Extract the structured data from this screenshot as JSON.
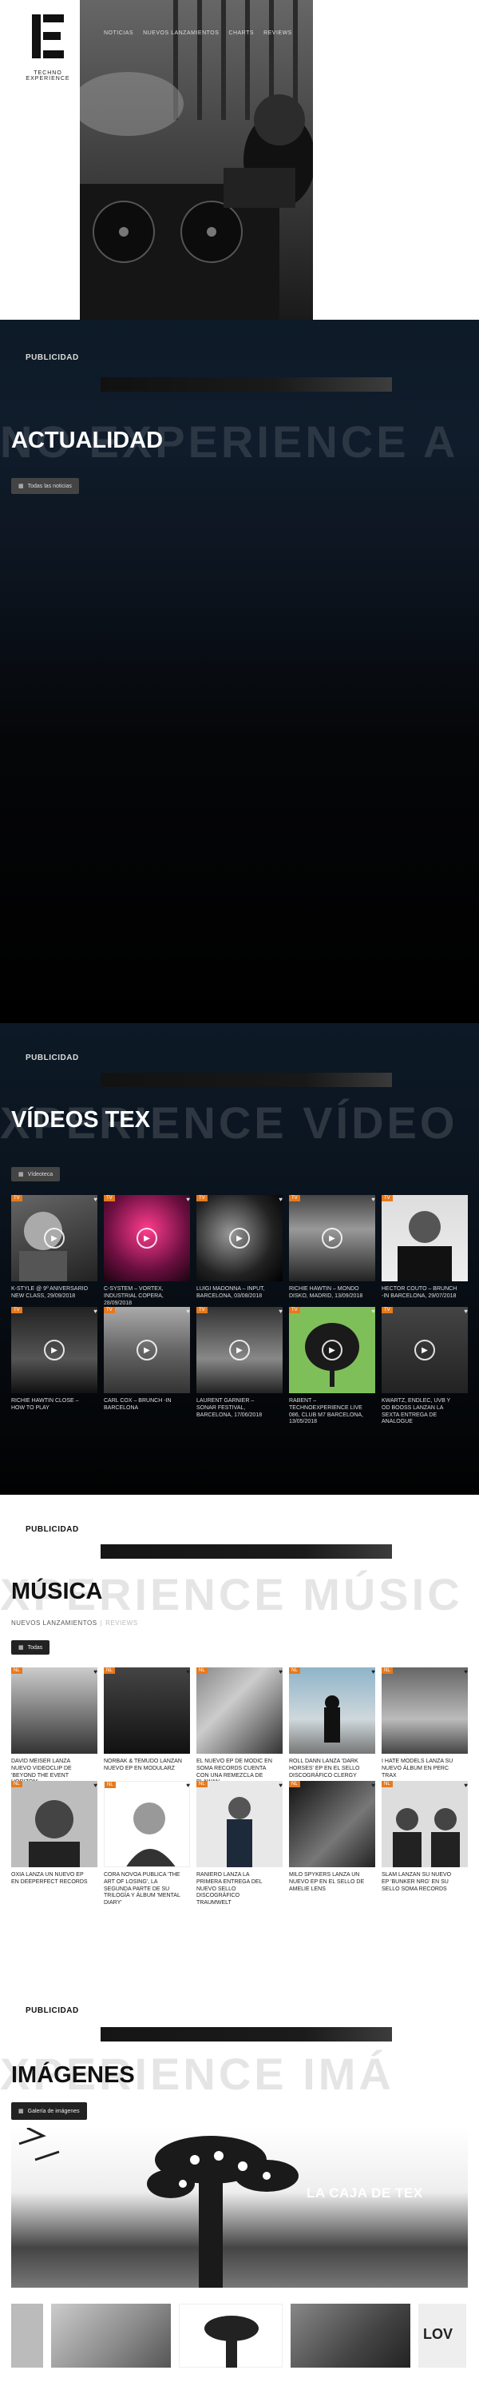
{
  "header": {
    "logo_text": "TECHNO EXPERIENCE",
    "nav": [
      "NOTICIAS",
      "NUEVOS LANZAMIENTOS",
      "CHARTS",
      "REVIEWS"
    ]
  },
  "ads": {
    "label": "PUBLICIDAD"
  },
  "news": {
    "watermark": "NO EXPERIENCE  A",
    "title": "ACTUALIDAD",
    "button": "Todas las noticias"
  },
  "videos": {
    "watermark": "XPERIENCE  VÍDEO",
    "title": "VÍDEOS TEX",
    "button": "Vídeoteca",
    "items": [
      {
        "badge": "TV",
        "caption": "K-STYLE @ 9º ANIVERSARIO NEW CLASS, 29/09/2018"
      },
      {
        "badge": "TV",
        "caption": "C-SYSTEM – VORTEX, INDUSTRIAL COPERA, 28/09/2018"
      },
      {
        "badge": "TV",
        "caption": "LUIGI MADONNA – INPUT, BARCELONA, 03/08/2018"
      },
      {
        "badge": "TV",
        "caption": "RICHIE HAWTIN – MONDO DISKO, MADRID, 13/09/2018"
      },
      {
        "badge": "TV",
        "caption": "HECTOR COUTO – BRUNCH -IN BARCELONA, 29/07/2018"
      },
      {
        "badge": "TV",
        "caption": "RICHIE HAWTIN CLOSE – HOW TO PLAY"
      },
      {
        "badge": "TV",
        "caption": "CARL COX – BRUNCH -IN BARCELONA"
      },
      {
        "badge": "TV",
        "caption": "LAURENT GARNIER – SONAR FESTIVAL, BARCELONA, 17/06/2018"
      },
      {
        "badge": "TV",
        "caption": "RABENT – TECHNOEXPERIENCE LIVE 086, CLUB M7 BARCELONA, 13/05/2018"
      },
      {
        "badge": "TV",
        "caption": "KWARTZ, ENDLEC, UVB Y OD BOOSS LANZAN LA SEXTA ENTREGA DE ANALOGUE"
      }
    ]
  },
  "music": {
    "watermark": "XPERIENCE  MÚSIC",
    "title": "MÚSICA",
    "tab_active": "NUEVOS LANZAMIENTOS",
    "tab_other": "REVIEWS",
    "button": "Todas",
    "items": [
      {
        "badge": "NL",
        "caption": "DAVID MEISER LANZA NUEVO VIDEOCLIP DE 'BEYOND THE EVENT HORIZON'"
      },
      {
        "badge": "NL",
        "caption": "NORBAK & TEMUDO LANZAN NUEVO EP EN MODULARZ"
      },
      {
        "badge": "NL",
        "caption": "EL NUEVO EP DE MODIC EN SOMA RECORDS CUENTA CON UNA REMEZCLA DE BLAWAN"
      },
      {
        "badge": "NL",
        "caption": "ROLL DANN LANZA 'DARK HORSES' EP EN EL SELLO DISCOGRÁFICO CLERGY"
      },
      {
        "badge": "NL",
        "caption": "I HATE MODELS LANZA SU NUEVO ÁLBUM EN PERC TRAX"
      },
      {
        "badge": "NL",
        "caption": "OXIA LANZA UN NUEVO EP EN DEEPERFECT RECORDS"
      },
      {
        "badge": "NL",
        "caption": "CORA NOVOA PUBLICA 'THE ART OF LOSING', LA SEGUNDA PARTE DE SU TRILOGÍA Y ÁLBUM 'MENTAL DIARY'"
      },
      {
        "badge": "NL",
        "caption": "RANIERO LANZA LA PRIMERA ENTREGA DEL NUEVO SELLO DISCOGRÁFICO TRAUMWELT"
      },
      {
        "badge": "NL",
        "caption": "MILO SPYKERS LANZA UN NUEVO EP EN EL SELLO DE AMELIE LENS"
      },
      {
        "badge": "NL",
        "caption": "SLAM LANZAN SU NUEVO EP 'BUNKER NRG' EN SU SELLO SOMA RECORDS"
      }
    ]
  },
  "images": {
    "watermark": "XPERIENCE  IMÁ",
    "title": "IMÁGENES",
    "button": "Galería de imágenes",
    "feature_caption": "LA CAJA DE TEX",
    "thumb_text": "LOV"
  },
  "colors": {
    "accent": "#e67a1e"
  }
}
